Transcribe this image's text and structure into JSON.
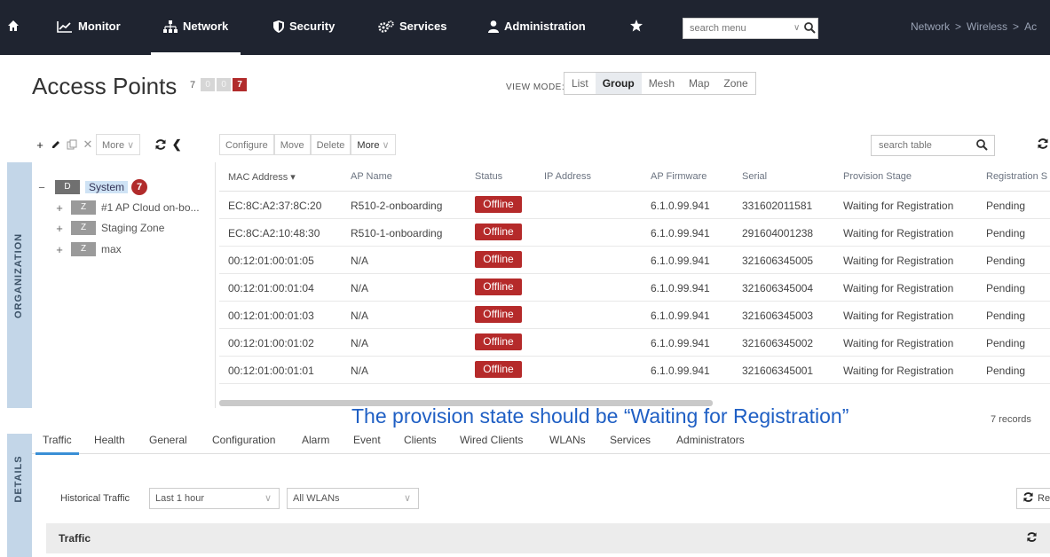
{
  "nav": {
    "items": [
      {
        "label": "Monitor",
        "icon": "chart-line-icon"
      },
      {
        "label": "Network",
        "icon": "network-icon"
      },
      {
        "label": "Security",
        "icon": "shield-icon"
      },
      {
        "label": "Services",
        "icon": "gears-icon"
      },
      {
        "label": "Administration",
        "icon": "user-icon"
      }
    ],
    "search_placeholder": "search menu",
    "breadcrumb": [
      "Network",
      ">",
      "Wireless",
      ">",
      "Ac"
    ]
  },
  "page": {
    "title": "Access Points",
    "count": "7",
    "badges": [
      "0",
      "0",
      "7"
    ],
    "view_mode_label": "VIEW MODE:",
    "view_modes": [
      "List",
      "Group",
      "Mesh",
      "Map",
      "Zone"
    ]
  },
  "toolbar": {
    "left_more": "More",
    "actions": [
      "Configure",
      "Move",
      "Delete"
    ],
    "right_more": "More",
    "search_placeholder": "search table"
  },
  "org": {
    "label": "ORGANIZATION",
    "root": {
      "chip": "D",
      "label": "System",
      "count": "7"
    },
    "children": [
      {
        "chip": "Z",
        "label": "#1 AP Cloud on-bo..."
      },
      {
        "chip": "Z",
        "label": "Staging Zone"
      },
      {
        "chip": "Z",
        "label": "max"
      }
    ]
  },
  "table": {
    "columns": [
      "MAC Address ▾",
      "AP Name",
      "Status",
      "IP Address",
      "AP Firmware",
      "Serial",
      "Provision Stage",
      "Registration S"
    ],
    "rows": [
      {
        "mac": "EC:8C:A2:37:8C:20",
        "name": "R510-2-onboarding",
        "status": "Offline",
        "ip": "",
        "fw": "6.1.0.99.941",
        "serial": "331602011581",
        "stage": "Waiting for Registration",
        "reg": "Pending"
      },
      {
        "mac": "EC:8C:A2:10:48:30",
        "name": "R510-1-onboarding",
        "status": "Offline",
        "ip": "",
        "fw": "6.1.0.99.941",
        "serial": "291604001238",
        "stage": "Waiting for Registration",
        "reg": "Pending"
      },
      {
        "mac": "00:12:01:00:01:05",
        "name": "N/A",
        "status": "Offline",
        "ip": "",
        "fw": "6.1.0.99.941",
        "serial": "321606345005",
        "stage": "Waiting for Registration",
        "reg": "Pending"
      },
      {
        "mac": "00:12:01:00:01:04",
        "name": "N/A",
        "status": "Offline",
        "ip": "",
        "fw": "6.1.0.99.941",
        "serial": "321606345004",
        "stage": "Waiting for Registration",
        "reg": "Pending"
      },
      {
        "mac": "00:12:01:00:01:03",
        "name": "N/A",
        "status": "Offline",
        "ip": "",
        "fw": "6.1.0.99.941",
        "serial": "321606345003",
        "stage": "Waiting for Registration",
        "reg": "Pending"
      },
      {
        "mac": "00:12:01:00:01:02",
        "name": "N/A",
        "status": "Offline",
        "ip": "",
        "fw": "6.1.0.99.941",
        "serial": "321606345002",
        "stage": "Waiting for Registration",
        "reg": "Pending"
      },
      {
        "mac": "00:12:01:00:01:01",
        "name": "N/A",
        "status": "Offline",
        "ip": "",
        "fw": "6.1.0.99.941",
        "serial": "321606345001",
        "stage": "Waiting for Registration",
        "reg": "Pending"
      }
    ],
    "records": "7 records",
    "annotation": "The provision state should be “Waiting for Registration”"
  },
  "details": {
    "label": "DETAILS",
    "tabs": [
      "Traffic",
      "Health",
      "General",
      "Configuration",
      "Alarm",
      "Event",
      "Clients",
      "Wired Clients",
      "WLANs",
      "Services",
      "Administrators"
    ],
    "historical_label": "Historical Traffic",
    "time_range": "Last 1 hour",
    "wlan_filter": "All WLANs",
    "refresh_label": "Re",
    "section_title": "Traffic"
  },
  "colors": {
    "nav_bg": "#1f2430",
    "offline": "#b52a2a",
    "badge_red": "#b12b2b",
    "annotation": "#1f5fc4",
    "side_strip": "#c3d6e8"
  }
}
